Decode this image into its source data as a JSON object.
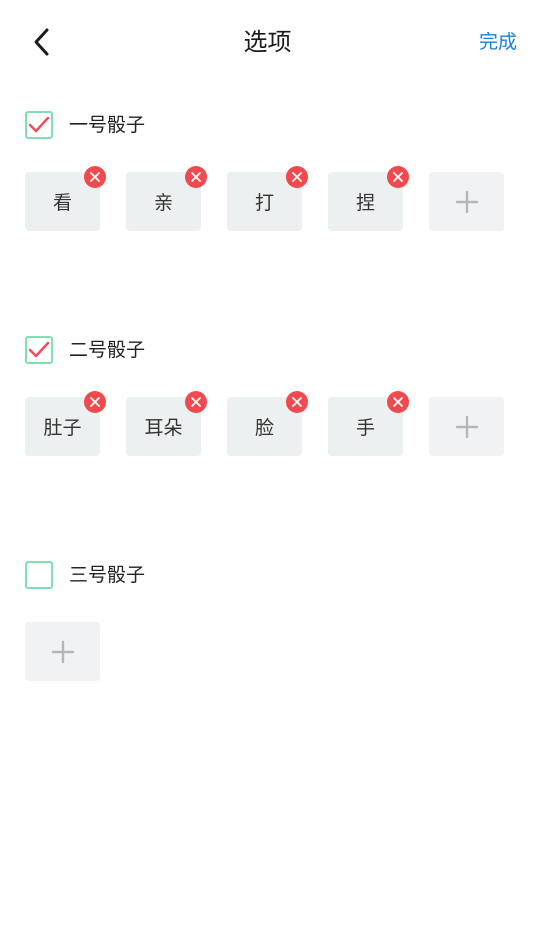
{
  "header": {
    "title": "选项",
    "done_label": "完成",
    "back_icon": "chevron-left-icon"
  },
  "colors": {
    "accent": "#1a7fd6",
    "checkbox_border": "#7fe0b3",
    "check_mark": "#f04a5a",
    "remove_badge": "#f04a4f",
    "chip_bg": "#edf0f0",
    "add_chip_bg": "#f1f2f4"
  },
  "groups": [
    {
      "label": "一号骰子",
      "checked": true,
      "options": [
        "看",
        "亲",
        "打",
        "捏"
      ]
    },
    {
      "label": "二号骰子",
      "checked": true,
      "options": [
        "肚子",
        "耳朵",
        "脸",
        "手"
      ]
    },
    {
      "label": "三号骰子",
      "checked": false,
      "options": []
    }
  ]
}
